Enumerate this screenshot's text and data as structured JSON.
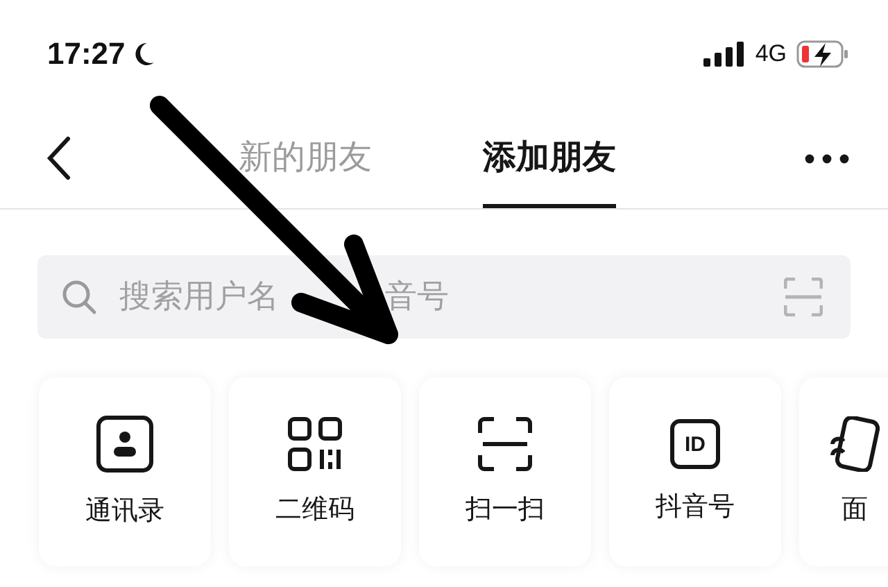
{
  "status_bar": {
    "time": "17:27",
    "network": "4G"
  },
  "tabs": [
    {
      "label": "新的朋友",
      "selected": false
    },
    {
      "label": "添加朋友",
      "selected": true
    }
  ],
  "search": {
    "placeholder": "搜索用户名　　　 音号"
  },
  "actions": [
    {
      "kind": "contacts",
      "label": "通讯录"
    },
    {
      "kind": "qrcode",
      "label": "二维码"
    },
    {
      "kind": "scan",
      "label": "扫一扫"
    },
    {
      "kind": "id",
      "label": "抖音号",
      "icon_text": "ID"
    },
    {
      "kind": "face",
      "label": "面"
    }
  ]
}
